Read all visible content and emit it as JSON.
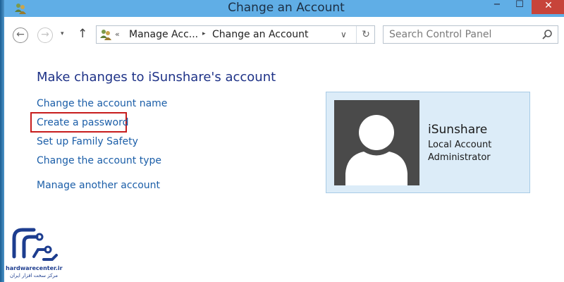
{
  "window": {
    "title": "Change an Account",
    "minimize_label": "−",
    "maximize_label": "☐",
    "close_label": "✕"
  },
  "nav": {
    "back_label": "←",
    "forward_label": "→",
    "dropdown_label": "▾",
    "up_label": "↑"
  },
  "address": {
    "chevrons": "«",
    "breadcrumbs": [
      "Manage Acc...",
      "Change an Account"
    ],
    "separator": "▸",
    "dropdown_label": "∨",
    "refresh_label": "↻"
  },
  "search": {
    "placeholder": "Search Control Panel"
  },
  "main": {
    "heading": "Make changes to iSunshare's account",
    "links": [
      "Change the account name",
      "Create a password",
      "Set up Family Safety",
      "Change the account type",
      "Manage another account"
    ]
  },
  "account": {
    "name": "iSunshare",
    "type": "Local Account",
    "role": "Administrator"
  },
  "watermark": {
    "domain": "hardwarecenter.ir",
    "subtitle": "مرکز سخت افزار ایران"
  },
  "colors": {
    "titlebar": "#60aee6",
    "link": "#1b5ea8",
    "heading": "#1e3287",
    "highlight": "#c71d1d",
    "card_bg": "#dcecf8",
    "close_button": "#c7443a"
  },
  "icons": {
    "app": "users-icon",
    "nav_back": "back-arrow-icon",
    "nav_forward": "forward-arrow-icon",
    "search": "search-icon",
    "refresh": "refresh-icon"
  }
}
